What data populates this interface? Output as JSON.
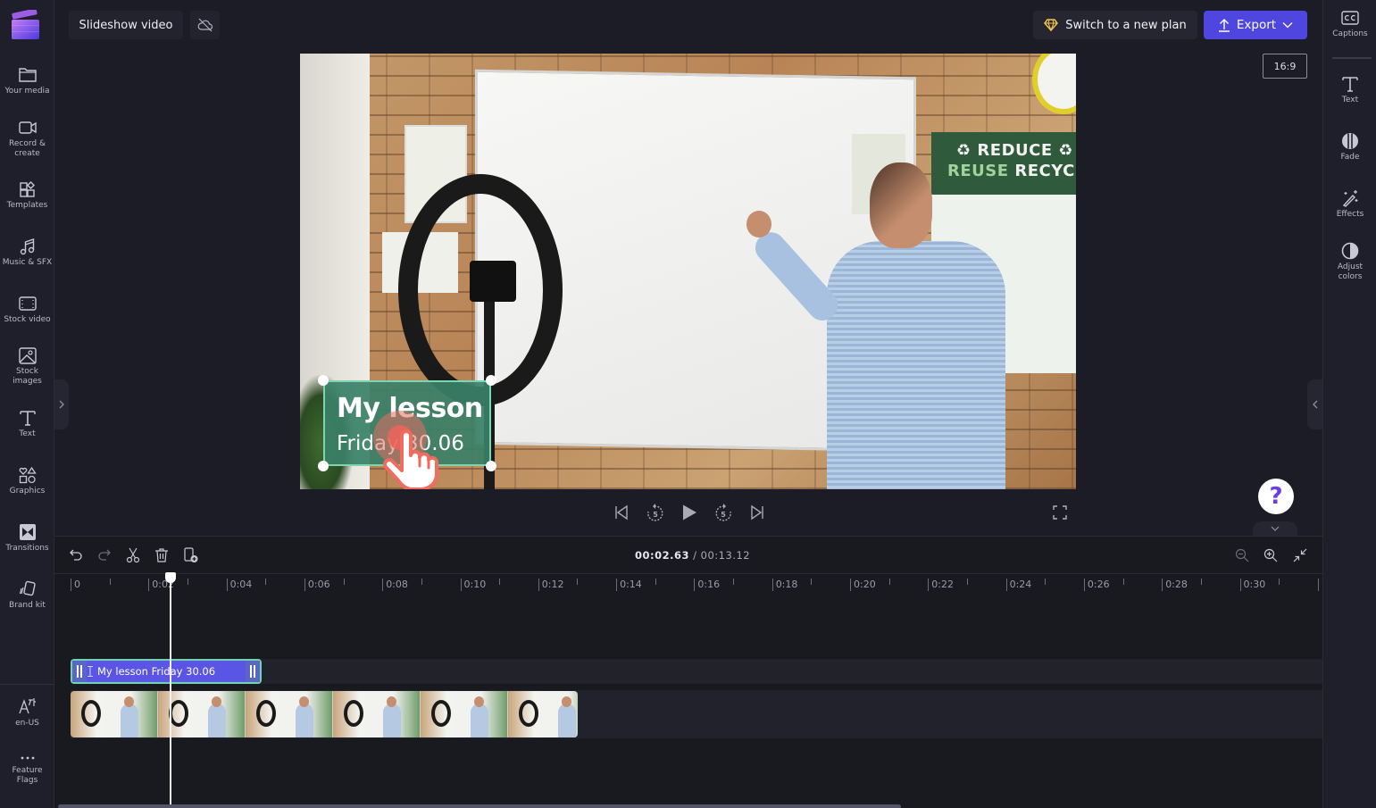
{
  "app": {
    "project_title": "Slideshow video",
    "accent_color": "#4f46e0"
  },
  "topbar": {
    "switch_plan_label": "Switch to a new plan",
    "export_label": "Export",
    "aspect_ratio": "16:9"
  },
  "left_sidebar": {
    "items": [
      {
        "label": "Your media",
        "icon": "folder-icon"
      },
      {
        "label": "Record &",
        "label2": "create",
        "icon": "camera-icon"
      },
      {
        "label": "Templates",
        "icon": "templates-icon"
      },
      {
        "label": "Music & SFX",
        "icon": "music-icon"
      },
      {
        "label": "Stock video",
        "icon": "film-icon"
      },
      {
        "label": "Stock",
        "label2": "images",
        "icon": "image-icon"
      },
      {
        "label": "Text",
        "icon": "text-icon"
      },
      {
        "label": "Graphics",
        "icon": "shapes-icon"
      },
      {
        "label": "Transitions",
        "icon": "transitions-icon"
      },
      {
        "label": "Brand kit",
        "icon": "brand-kit-icon"
      }
    ],
    "bottom_items": [
      {
        "label": "en-US",
        "icon": "language-icon"
      },
      {
        "label": "Feature",
        "label2": "Flags",
        "icon": "more-icon"
      }
    ]
  },
  "right_sidebar": {
    "items": [
      {
        "label": "Captions",
        "icon": "captions-icon"
      },
      {
        "label": "Text",
        "icon": "text-icon"
      },
      {
        "label": "Fade",
        "icon": "fade-icon"
      },
      {
        "label": "Effects",
        "icon": "magic-wand-icon"
      },
      {
        "label": "Adjust",
        "label2": "colors",
        "icon": "contrast-icon"
      }
    ]
  },
  "preview": {
    "overlay_title": "My lesson",
    "overlay_subtitle": "Friday 30.06",
    "poster_line1": "REDUCE",
    "poster_line2a": "REUSE",
    "poster_line2b": "RECYCLE",
    "help_label": "?"
  },
  "timeline": {
    "current_time": "00:02.63",
    "separator": " / ",
    "total_time": "00:13.12",
    "ruler_labels": [
      "0",
      "0:02",
      "0:04",
      "0:06",
      "0:08",
      "0:10",
      "0:12",
      "0:14",
      "0:16",
      "0:18",
      "0:20",
      "0:22",
      "0:24",
      "0:26",
      "0:28",
      "0:30"
    ],
    "text_clip_label": "My lesson Friday 30.06",
    "video_thumbnail_count": 6
  }
}
